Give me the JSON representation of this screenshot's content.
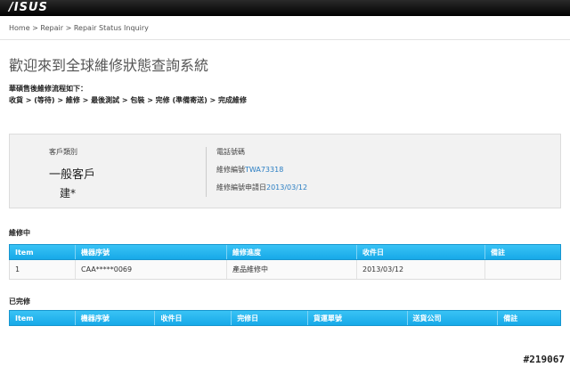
{
  "header": {
    "logo_text": "/ISUS"
  },
  "breadcrumb": {
    "home": "Home",
    "sep": " > ",
    "repair": "Repair",
    "current": "Repair Status Inquiry"
  },
  "page": {
    "title": "歡迎來到全球維修狀態查詢系統",
    "flow_title": "華碩售後維修流程如下：",
    "flow_steps": "收貨 > (等待) > 維修 > 最後測試 > 包裝 > 完修 (準備寄送) > 完成維修"
  },
  "info": {
    "customer_type_label": "客戶類別",
    "customer_type": "一般客戶",
    "customer_name": "建*",
    "phone_label": "電話號碼",
    "repair_no_label": "維修編號",
    "repair_no": "TWA73318",
    "apply_date_label": "維修編號申請日",
    "apply_date": "2013/03/12"
  },
  "in_repair": {
    "title": "維修中",
    "headers": [
      "Item",
      "機器序號",
      "維修進度",
      "收件日",
      "備註"
    ],
    "rows": [
      [
        "1",
        "CAA*****0069",
        "產品維修中",
        "2013/03/12",
        ""
      ]
    ]
  },
  "completed": {
    "title": "已完修",
    "headers": [
      "Item",
      "機器序號",
      "收件日",
      "完修日",
      "貨運單號",
      "送貨公司",
      "備註"
    ]
  },
  "watermark": "#219067"
}
